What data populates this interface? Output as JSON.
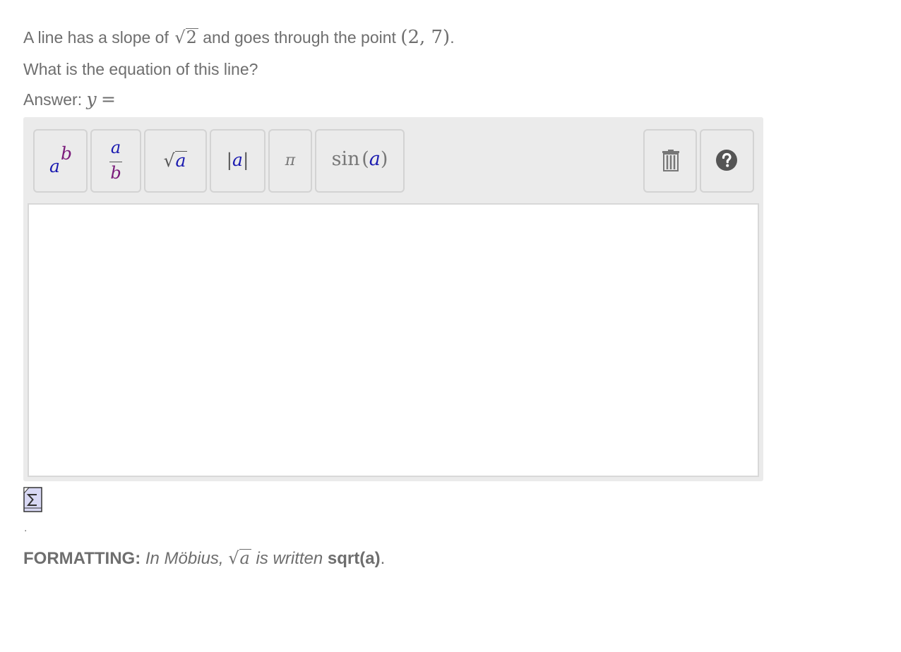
{
  "question": {
    "line1_prefix": "A line has a slope of",
    "slope_radicand": "2",
    "line1_middle": "and goes through the point",
    "point": "(2, 7)",
    "line1_end": ".",
    "line2": "What is the equation of this line?",
    "answer_label": "Answer:",
    "answer_var": "y",
    "answer_eq": "="
  },
  "toolbar": {
    "power": {
      "base": "a",
      "exp": "b"
    },
    "fraction": {
      "num": "a",
      "den": "b"
    },
    "sqrt": {
      "arg": "a"
    },
    "abs": {
      "arg": "a"
    },
    "pi": "π",
    "sin": {
      "fn": "sin",
      "arg": "a"
    }
  },
  "input": {
    "value": ""
  },
  "below": {
    "dot": "."
  },
  "formatting": {
    "label": "FORMATTING:",
    "text1": "In Möbius,",
    "sqrt_arg": "a",
    "text2": "is written",
    "code": "sqrt(a)",
    "end": "."
  },
  "colors": {
    "accent_blue": "#1a1ab0",
    "accent_purple": "#7a1a7a",
    "text_gray": "#6e6e6e"
  },
  "icons": [
    "sigma-icon",
    "trash-icon",
    "help-icon"
  ]
}
